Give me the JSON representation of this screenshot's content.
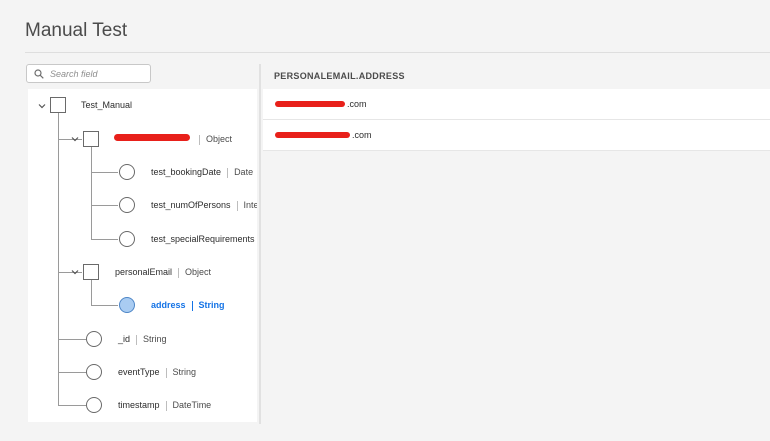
{
  "page": {
    "title": "Manual Test"
  },
  "search": {
    "placeholder": "Search field"
  },
  "tree": {
    "root": {
      "label": "Test_Manual"
    },
    "group1": {
      "label": "",
      "type": "Object"
    },
    "fields1": [
      {
        "label": "test_bookingDate",
        "type": "Date"
      },
      {
        "label": "test_numOfPersons",
        "type": "Integ"
      },
      {
        "label": "test_specialRequirements",
        "type": ""
      }
    ],
    "personalEmail": {
      "label": "personalEmail",
      "type": "Object"
    },
    "address": {
      "label": "address",
      "type": "String"
    },
    "rootFields": [
      {
        "label": "_id",
        "type": "String"
      },
      {
        "label": "eventType",
        "type": "String"
      },
      {
        "label": "timestamp",
        "type": "DateTime"
      }
    ]
  },
  "results": {
    "column_header": "PERSONALEMAIL.ADDRESS",
    "rows": [
      {
        "value": ".com"
      },
      {
        "value": ".com"
      }
    ]
  },
  "colors": {
    "accent": "#1473e6",
    "redaction": "#e8201a",
    "selected_radio": "#a9ccf2"
  },
  "icons": {
    "search": "search-icon",
    "expand": "chevron-down-icon"
  }
}
